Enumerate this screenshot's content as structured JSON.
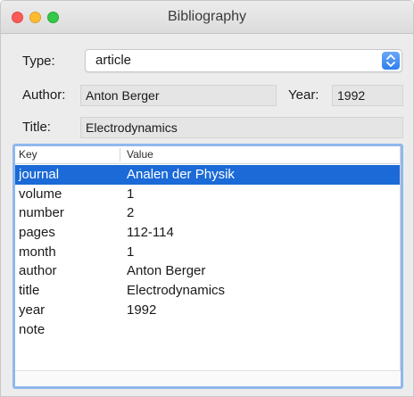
{
  "window": {
    "title": "Bibliography"
  },
  "form": {
    "type_label": "Type:",
    "type_value": "article",
    "author_label": "Author:",
    "author_value": "Anton Berger",
    "year_label": "Year:",
    "year_value": "1992",
    "title_label": "Title:",
    "title_value": "Electrodynamics"
  },
  "table": {
    "columns": [
      "Key",
      "Value"
    ],
    "selected_row": 0,
    "rows": [
      {
        "key": "journal",
        "value": "Analen der Physik"
      },
      {
        "key": "volume",
        "value": "1"
      },
      {
        "key": "number",
        "value": "2"
      },
      {
        "key": "pages",
        "value": "112-114"
      },
      {
        "key": "month",
        "value": "1"
      },
      {
        "key": "author",
        "value": "Anton Berger"
      },
      {
        "key": "title",
        "value": "Electrodynamics"
      },
      {
        "key": "year",
        "value": "1992"
      },
      {
        "key": "note",
        "value": ""
      }
    ]
  },
  "colors": {
    "selection": "#1b6ad7",
    "focus_ring": "#8fb8ec",
    "popup_arrow": "#2e7ff0"
  }
}
